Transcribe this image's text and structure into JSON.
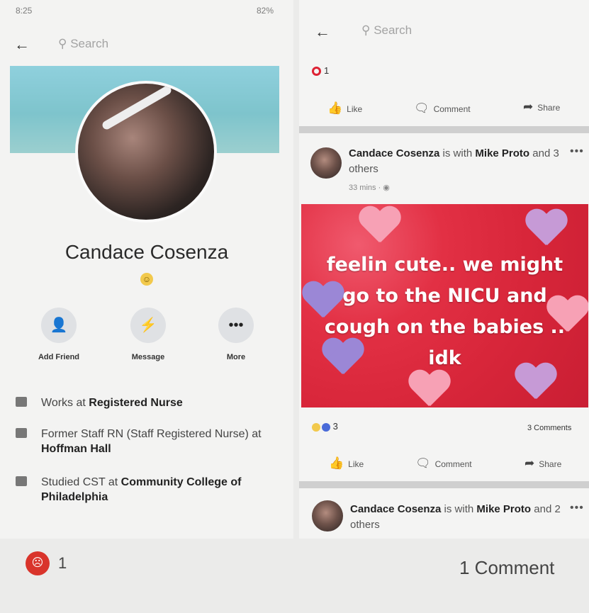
{
  "left": {
    "status_time": "8:25",
    "status_battery": "82%",
    "search_placeholder": "Search",
    "profile_name": "Candace Cosenza",
    "actions": {
      "add_friend": "Add Friend",
      "message": "Message",
      "more": "More"
    },
    "info": {
      "work_prefix": "Works at ",
      "work_value": "Registered Nurse",
      "former_prefix": "Former Staff RN (Staff Registered Nurse) at ",
      "former_value": "Hoffman Hall",
      "studied_prefix": "Studied CST at ",
      "studied_value": "Community College of Philadelphia"
    },
    "bottom_reaction_count": "1"
  },
  "right": {
    "search_placeholder": "Search",
    "top_reaction_count": "1",
    "actions": {
      "like": "Like",
      "comment": "Comment",
      "share": "Share"
    },
    "post1": {
      "author": "Candace Cosenza",
      "with_text": " is with ",
      "tagged": "Mike Proto",
      "others": " and 3 others",
      "time": "33 mins · ",
      "image_text": "feelin cute.. we might go to the NICU and cough on the babies .. idk",
      "reaction_count": "3",
      "comments_count": "3 Comments"
    },
    "post2": {
      "author": "Candace Cosenza",
      "with_text": " is with ",
      "tagged": "Mike Proto",
      "others": " and 2 others"
    }
  },
  "bottom": {
    "comment_count": "1 Comment"
  },
  "colors": {
    "post_bg": "#d8263a",
    "angry_reaction": "#d9342b",
    "cover": "#8fd0dd"
  }
}
